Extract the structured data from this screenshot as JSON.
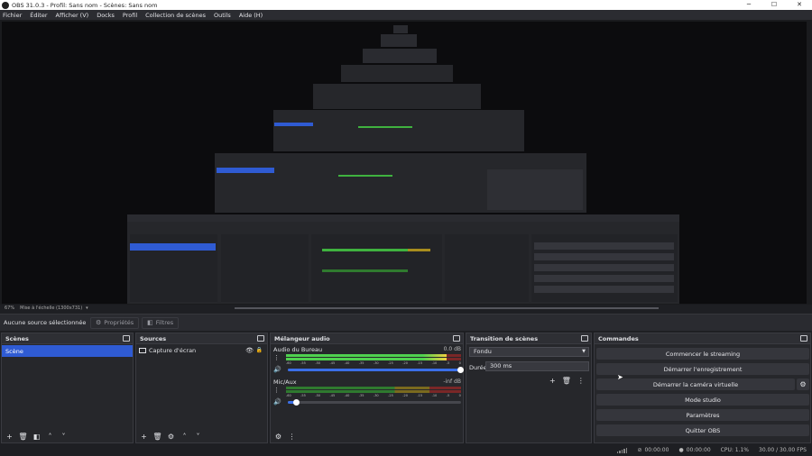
{
  "window": {
    "title": "OBS 31.0.3 - Profil: Sans nom - Scènes: Sans nom",
    "controls": [
      "─",
      "☐",
      "✕"
    ]
  },
  "menu": [
    "Fichier",
    "Éditer",
    "Afficher (V)",
    "Docks",
    "Profil",
    "Collection de scènes",
    "Outils",
    "Aide (H)"
  ],
  "preview": {
    "zoom": "67%",
    "scale_label": "Mise à l'échelle (1300x731)"
  },
  "context_bar": {
    "no_source": "Aucune source sélectionnée",
    "properties": "Propriétés",
    "filters": "Filtres"
  },
  "scenes": {
    "title": "Scènes",
    "items": [
      "Scène"
    ]
  },
  "sources": {
    "title": "Sources",
    "items": [
      "Capture d'écran"
    ]
  },
  "mixer": {
    "title": "Mélangeur audio",
    "channels": [
      {
        "name": "Audio du Bureau",
        "db": "0.0 dB",
        "level": 0.92,
        "volume": 1.0
      },
      {
        "name": "Mic/Aux",
        "db": "-inf dB",
        "level": 0.0,
        "volume": 0.05
      }
    ],
    "ticks": [
      "-60",
      "-55",
      "-50",
      "-45",
      "-40",
      "-35",
      "-30",
      "-25",
      "-20",
      "-15",
      "-10",
      "-5",
      "0"
    ]
  },
  "transitions": {
    "title": "Transition de scènes",
    "selected": "Fondu",
    "duration_label": "Durée",
    "duration_value": "300 ms"
  },
  "commands": {
    "title": "Commandes",
    "buttons": [
      "Commencer le streaming",
      "Démarrer l'enregistrement",
      "Démarrer la caméra virtuelle",
      "Mode studio",
      "Paramètres",
      "Quitter OBS"
    ]
  },
  "status": {
    "stream_time": "00:00:00",
    "rec_time": "00:00:00",
    "cpu": "CPU: 1.1%",
    "fps": "30.00 / 30.00 FPS"
  },
  "colors": {
    "accent": "#2f5bd3",
    "panel": "#26272b",
    "meter_green": "#4fd14f",
    "meter_yellow": "#f0d040",
    "meter_red": "#d13c3c"
  }
}
